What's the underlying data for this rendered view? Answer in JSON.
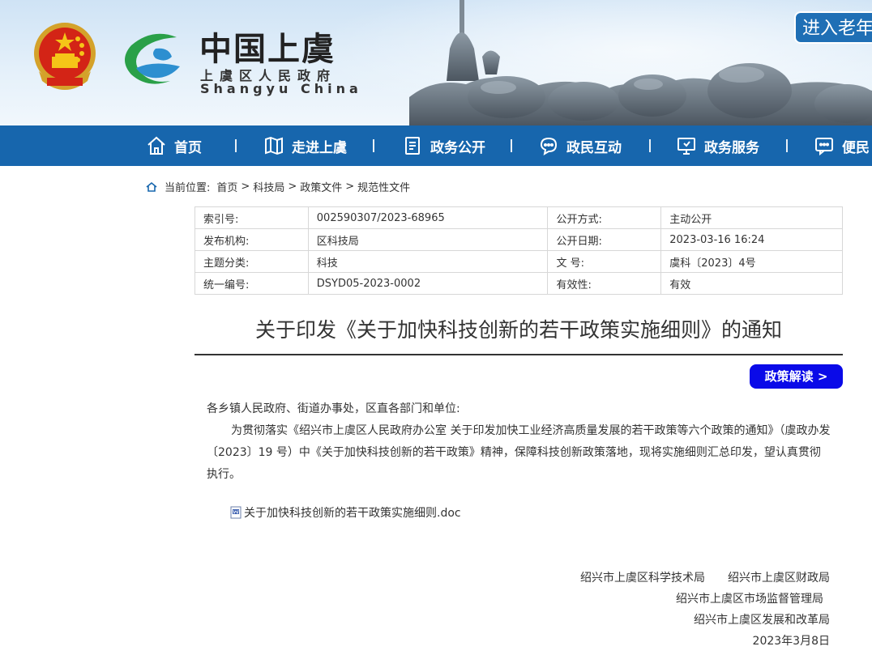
{
  "header": {
    "brand_cn": "中国上虞",
    "brand_sub": "上虞区人民政府",
    "brand_en": "Shangyu China",
    "elder_mode_label": "进入老年"
  },
  "nav": {
    "items": [
      {
        "label": "首页",
        "icon": "home-icon"
      },
      {
        "label": "走进上虞",
        "icon": "map-icon"
      },
      {
        "label": "政务公开",
        "icon": "document-icon"
      },
      {
        "label": "政民互动",
        "icon": "chat-icon"
      },
      {
        "label": "政务服务",
        "icon": "monitor-icon"
      },
      {
        "label": "便民",
        "icon": "message-icon"
      }
    ]
  },
  "breadcrumb": {
    "prefix": "当前位置:",
    "items": [
      "首页",
      "科技局",
      "政策文件",
      "规范性文件"
    ],
    "separator": ">"
  },
  "meta": {
    "rows": [
      [
        "索引号:",
        "002590307/2023-68965",
        "公开方式:",
        "主动公开"
      ],
      [
        "发布机构:",
        "区科技局",
        "公开日期:",
        "2023-03-16 16:24"
      ],
      [
        "主题分类:",
        "科技",
        "文 号:",
        "虞科〔2023〕4号"
      ],
      [
        "统一编号:",
        "DSYD05-2023-0002",
        "有效性:",
        "有效"
      ]
    ]
  },
  "article": {
    "title": "关于印发《关于加快科技创新的若干政策实施细则》的通知",
    "interpret_button": "政策解读 >",
    "greeting": "各乡镇人民政府、街道办事处，区直各部门和单位:",
    "paragraph": "为贯彻落实《绍兴市上虞区人民政府办公室 关于印发加快工业经济高质量发展的若干政策等六个政策的通知》（虞政办发〔2023〕19 号）中《关于加快科技创新的若干政策》精神，保障科技创新政策落地，现将实施细则汇总印发，望认真贯彻执行。",
    "attachment": "关于加快科技创新的若干政策实施细则.doc",
    "signatures": [
      "绍兴市上虞区科学技术局　　绍兴市上虞区财政局",
      "绍兴市上虞区市场监督管理局",
      "绍兴市上虞区发展和改革局",
      "2023年3月8日"
    ]
  },
  "colors": {
    "nav_bg": "#1766ad",
    "interpret_btn": "#0a0ae8",
    "elder_btn": "#1f6fb5"
  }
}
